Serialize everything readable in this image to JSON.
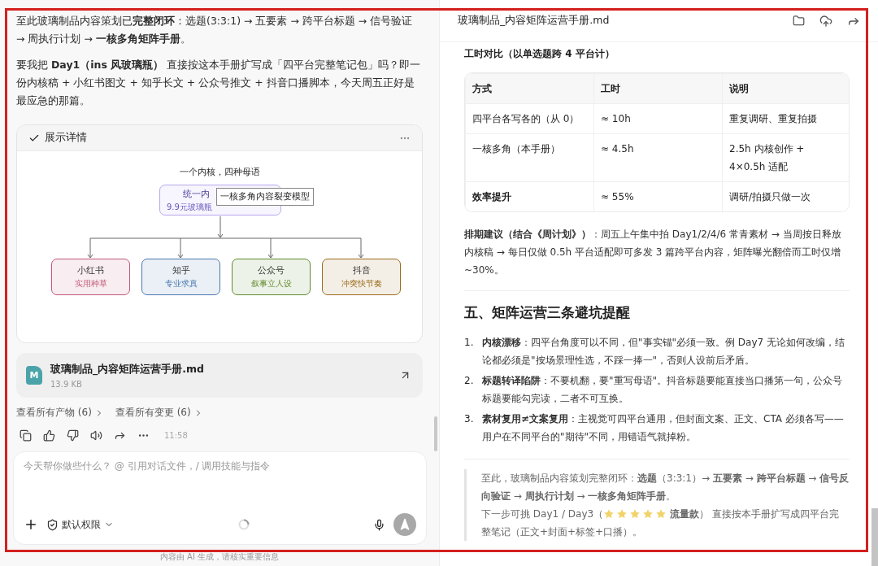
{
  "chat": {
    "paragraphs": [
      "至此玻璃制品内容策划已**完整闭环**：选题(3:3:1) → 五要素 → 跨平台标题 → 信号验证 → 周执行计划 → **一核多角矩阵手册**。",
      "要我把 **Day1（ins 风玻璃瓶）** 直接按这本手册扩写成「四平台完整笔记包」吗？即一份内核稿 + 小红书图文 + 知乎长文 + 公众号推文 + 抖音口播脚本，今天周五正好是最应急的那篇。"
    ]
  },
  "card": {
    "title": "展示详情",
    "diagram": {
      "title": "一个内核，四种母语",
      "root": {
        "title": "统一内",
        "subtitle": "9.9元玻璃瓶"
      },
      "tooltip": "一核多角内容裂变模型",
      "children": [
        {
          "title": "小红书",
          "subtitle": "实用种草",
          "color": "#c0577a"
        },
        {
          "title": "知乎",
          "subtitle": "专业求真",
          "color": "#4a78b0"
        },
        {
          "title": "公众号",
          "subtitle": "叙事立人设",
          "color": "#5f8a2c"
        },
        {
          "title": "抖音",
          "subtitle": "冲突快节奏",
          "color": "#9a6a1c"
        }
      ]
    }
  },
  "file": {
    "badge": "M",
    "name": "玻璃制品_内容矩阵运营手册.md",
    "size": "13.9 KB"
  },
  "links": [
    "查看所有产物 (6)",
    "查看所有变更 (6)"
  ],
  "time": "11:58",
  "composer": {
    "placeholder": "今天帮你做些什么？ @ 引用对话文件，/ 调用技能与指令",
    "permission": "默认权限"
  },
  "disclaimer": "内容由 AI 生成，请核实重要信息",
  "doc": {
    "title": "玻璃制品_内容矩阵运营手册.md",
    "caption": "工时对比（以单选题跨 4 平台计）",
    "table": {
      "columns": [
        "方式",
        "工时",
        "说明"
      ],
      "rows": [
        {
          "cells": [
            "四平台各写各的（从 0）",
            "≈ 10h",
            "重复调研、重复拍摄"
          ],
          "emphasis": false
        },
        {
          "cells": [
            "一核多角（本手册）",
            "≈ 4.5h",
            "2.5h 内核创作 + 4×0.5h 适配"
          ],
          "emphasis": false
        },
        {
          "cells": [
            "效率提升",
            "≈ 55%",
            "调研/拍摄只做一次"
          ],
          "emphasis": true
        }
      ]
    },
    "schedule": "**排期建议（结合《周计划》）**：周五上午集中拍 Day1/2/4/6 常青素材 → 当周按日释放内核稿 → 每日仅做 0.5h 平台适配即可多发 3 篇跨平台内容，矩阵曝光翻倍而工时仅增 ~30%。",
    "heading": "五、矩阵运营三条避坑提醒",
    "tips": [
      {
        "number": "1.",
        "text": "**内核漂移**：四平台角度可以不同，但\"事实锚\"必须一致。例 Day7 无论如何改编，结论都必须是\"按场景理性选，不踩一捧一\"，否则人设前后矛盾。"
      },
      {
        "number": "2.",
        "text": "**标题转译陷阱**：不要机翻，要\"重写母语\"。抖音标题要能直接当口播第一句，公众号标题要能勾完读，二者不可互换。"
      },
      {
        "number": "3.",
        "text": "**素材复用≠文案复用**：主视觉可四平台通用，但封面文案、正文、CTA 必须各写——用户在不同平台的\"期待\"不同，用错语气就掉粉。"
      }
    ],
    "quote": {
      "text": "至此，玻璃制品内容策划完整闭环：**选题**（3:3:1）→ **五要素** → **跨平台标题** → **信号反向验证** → **周执行计划** → **一核多角矩阵手册**。",
      "before": "下一步可挑 Day1 / Day3（",
      "stars": 5,
      "after": "**流量款**） 直接按本手册扩写成四平台完",
      "continued": "整笔记（正文+封面+标签+口播）。"
    }
  }
}
